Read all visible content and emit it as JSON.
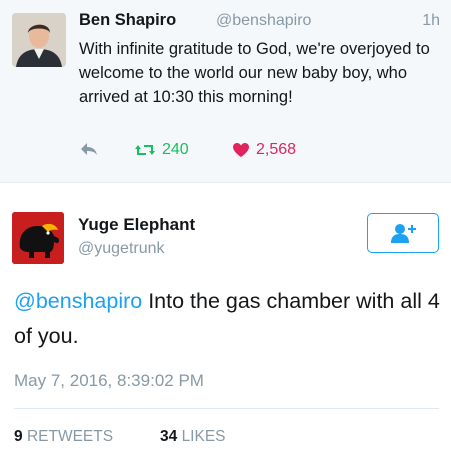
{
  "parent_tweet": {
    "name": "Ben Shapiro",
    "handle": "@benshapiro",
    "time": "1h",
    "text": "With infinite gratitude to God, we're overjoyed to welcome to the world our new baby boy, who arrived at 10:30 this morning!",
    "retweets": "240",
    "likes": "2,568",
    "icons": {
      "reply": "reply-icon",
      "retweet": "retweet-icon",
      "like": "heart-icon"
    },
    "colors": {
      "retweet": "#17bf63",
      "like": "#e0245e",
      "muted": "#8899a6",
      "background": "#f5f8fa"
    }
  },
  "main_tweet": {
    "name": "Yuge Elephant",
    "handle": "@yugetrunk",
    "mention": "@benshapiro",
    "text": " Into the gas chamber with all 4 of you.",
    "date": "May 7, 2016, 8:39:02 PM",
    "retweets_count": "9",
    "retweets_label": "RETWEETS",
    "likes_count": "34",
    "likes_label": "LIKES",
    "follow_icon": "add-user-icon",
    "colors": {
      "accent": "#1da1f2",
      "avatar": "#c81e1e"
    }
  }
}
